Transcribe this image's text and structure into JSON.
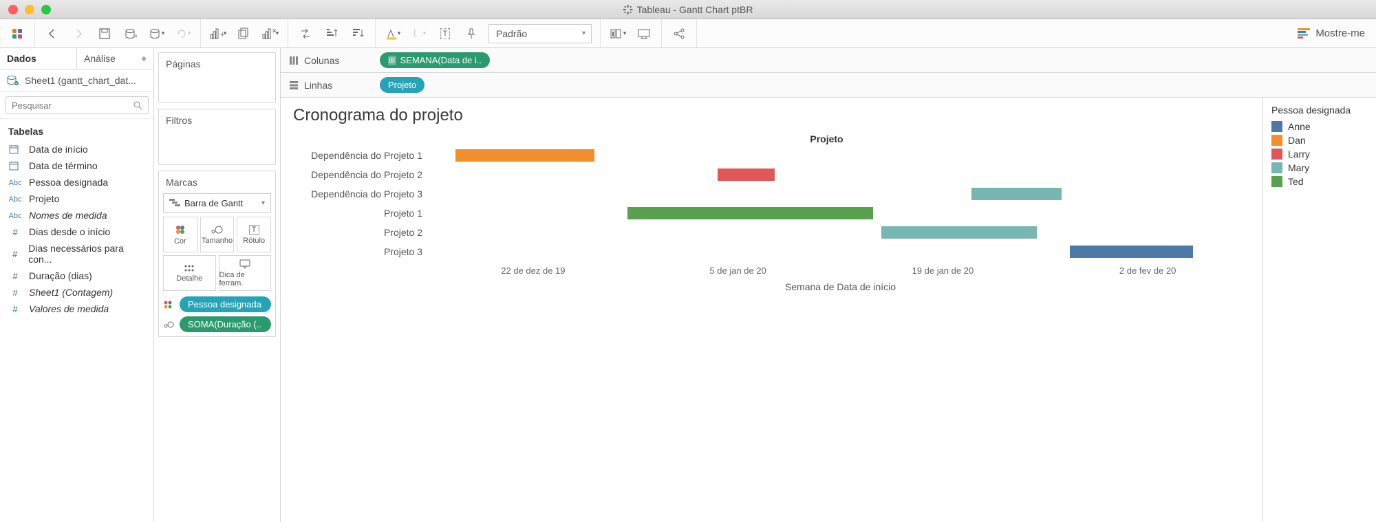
{
  "window": {
    "title": "Tableau - Gantt Chart ptBR"
  },
  "toolbar": {
    "fit_select": "Padrão",
    "showme": "Mostre-me"
  },
  "data_pane": {
    "tabs": {
      "data": "Dados",
      "analysis": "Análise"
    },
    "source": "Sheet1 (gantt_chart_dat...",
    "search_placeholder": "Pesquisar",
    "tables_label": "Tabelas",
    "fields": [
      {
        "type": "date",
        "label": "Data de início"
      },
      {
        "type": "date",
        "label": "Data de término"
      },
      {
        "type": "abc",
        "label": "Pessoa designada"
      },
      {
        "type": "abc",
        "label": "Projeto"
      },
      {
        "type": "abc",
        "label": "Nomes de medida",
        "italic": true
      },
      {
        "type": "hash",
        "label": "Dias desde o início"
      },
      {
        "type": "hash",
        "label": "Dias necessários para con..."
      },
      {
        "type": "hash",
        "label": "Duração (dias)"
      },
      {
        "type": "hash",
        "label": "Sheet1 (Contagem)",
        "italic": true
      },
      {
        "type": "hash",
        "label": "Valores de medida",
        "italic": true
      }
    ]
  },
  "shelves": {
    "pages": "Páginas",
    "filters": "Filtros",
    "marks": "Marcas",
    "mark_type": "Barra de Gantt",
    "cells": {
      "color": "Cor",
      "size": "Tamanho",
      "label": "Rótulo",
      "detail": "Detalhe",
      "tooltip": "Dica de ferram."
    },
    "mark_pills": [
      {
        "icon": "color",
        "pill": "Pessoa designada",
        "class": "teal"
      },
      {
        "icon": "size",
        "pill": "SOMA(Duração (..",
        "class": "green"
      }
    ]
  },
  "colrow": {
    "columns_label": "Colunas",
    "columns_pill": "SEMANA(Data de i..",
    "rows_label": "Linhas",
    "rows_pill": "Projeto"
  },
  "chart": {
    "title": "Cronograma do projeto",
    "header": "Projeto",
    "x_label": "Semana de Data de início"
  },
  "legend": {
    "title": "Pessoa designada",
    "items": [
      {
        "label": "Anne",
        "color": "c-blue"
      },
      {
        "label": "Dan",
        "color": "c-orange"
      },
      {
        "label": "Larry",
        "color": "c-red"
      },
      {
        "label": "Mary",
        "color": "c-teal"
      },
      {
        "label": "Ted",
        "color": "c-green"
      }
    ]
  },
  "chart_data": {
    "type": "bar",
    "title": "Cronograma do projeto",
    "xlabel": "Semana de Data de início",
    "ylabel": "Projeto",
    "x_ticks": [
      "22 de dez de 19",
      "5 de jan de 20",
      "19 de jan de 20",
      "2 de fev de 20"
    ],
    "categories": [
      "Dependência do Projeto 1",
      "Dependência do Projeto 2",
      "Dependência do Projeto 3",
      "Projeto 1",
      "Projeto 2",
      "Projeto 3"
    ],
    "series": [
      {
        "name": "Dependência do Projeto 1",
        "assignee": "Dan",
        "color": "#f28e2b",
        "start": "22 de dez de 19",
        "left_pct": 3,
        "width_pct": 17
      },
      {
        "name": "Dependência do Projeto 2",
        "assignee": "Larry",
        "color": "#e15759",
        "start": "5 de jan de 20",
        "left_pct": 35,
        "width_pct": 7
      },
      {
        "name": "Dependência do Projeto 3",
        "assignee": "Mary",
        "color": "#76b7b2",
        "start": "19 de jan de 20",
        "left_pct": 66,
        "width_pct": 11
      },
      {
        "name": "Projeto 1",
        "assignee": "Ted",
        "color": "#59a14f",
        "start": "29 de dez de 19",
        "left_pct": 24,
        "width_pct": 30
      },
      {
        "name": "Projeto 2",
        "assignee": "Mary",
        "color": "#76b7b2",
        "start": "12 de jan de 20",
        "left_pct": 55,
        "width_pct": 19
      },
      {
        "name": "Projeto 3",
        "assignee": "Anne",
        "color": "#4e79a7",
        "start": "2 de fev de 20",
        "left_pct": 78,
        "width_pct": 15
      }
    ]
  }
}
